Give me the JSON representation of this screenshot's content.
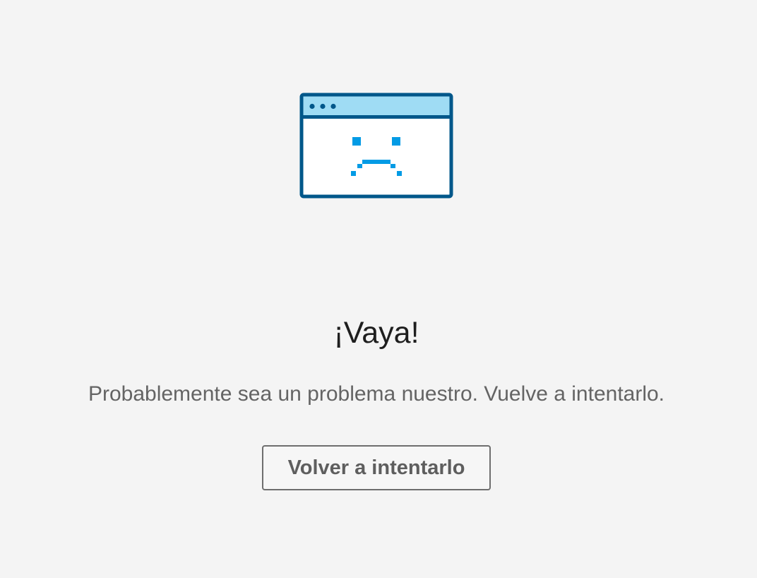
{
  "error": {
    "illustration_icon": "sad-browser-window-icon",
    "title": "¡Vaya!",
    "message": "Probablemente sea un problema nuestro. Vuelve a intentarlo.",
    "retry_label": "Volver a intentarlo"
  },
  "colors": {
    "background": "#f4f4f4",
    "illustration_frame": "#00578a",
    "illustration_titlebar": "#9fdcf4",
    "illustration_face": "#039be5",
    "title_text": "#1e1e1e",
    "message_text": "#646464",
    "button_border": "#6e6e6e",
    "button_text": "#5e5e5e"
  }
}
